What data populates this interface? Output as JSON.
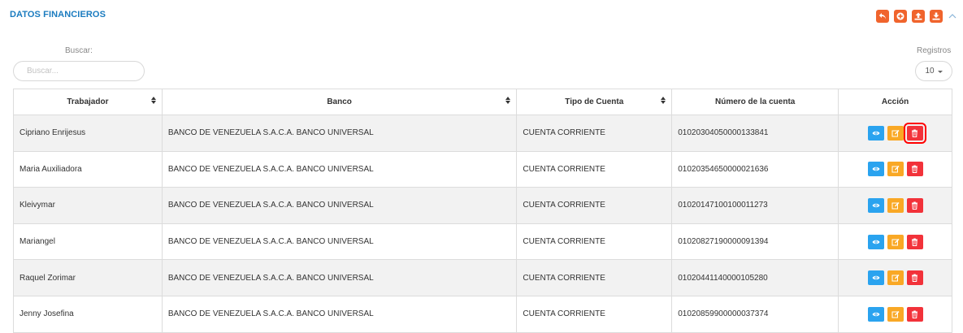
{
  "header": {
    "title": "DATOS FINANCIEROS",
    "toolbar": [
      {
        "name": "back-button",
        "icon": "undo-icon"
      },
      {
        "name": "add-button",
        "icon": "plus-circle-icon"
      },
      {
        "name": "upload-button",
        "icon": "upload-icon"
      },
      {
        "name": "download-button",
        "icon": "download-icon"
      }
    ],
    "collapse_icon": "chevron-up-icon"
  },
  "search": {
    "label": "Buscar:",
    "placeholder": "Buscar..."
  },
  "records": {
    "label": "Registros",
    "value": "10"
  },
  "table": {
    "columns": [
      "Trabajador",
      "Banco",
      "Tipo de Cuenta",
      "Número de la cuenta",
      "Acción"
    ],
    "rows": [
      {
        "trabajador": "Cipriano Enrijesus",
        "banco": "BANCO DE VENEZUELA S.A.C.A. BANCO UNIVERSAL",
        "tipo": "CUENTA CORRIENTE",
        "numero": "01020304050000133841"
      },
      {
        "trabajador": "Maria Auxiliadora",
        "banco": "BANCO DE VENEZUELA S.A.C.A. BANCO UNIVERSAL",
        "tipo": "CUENTA CORRIENTE",
        "numero": "01020354650000021636"
      },
      {
        "trabajador": "Kleivymar",
        "banco": "BANCO DE VENEZUELA S.A.C.A. BANCO UNIVERSAL",
        "tipo": "CUENTA CORRIENTE",
        "numero": "01020147100100011273"
      },
      {
        "trabajador": "Mariangel",
        "banco": "BANCO DE VENEZUELA S.A.C.A. BANCO UNIVERSAL",
        "tipo": "CUENTA CORRIENTE",
        "numero": "01020827190000091394"
      },
      {
        "trabajador": "Raquel Zorimar",
        "banco": "BANCO DE VENEZUELA S.A.C.A. BANCO UNIVERSAL",
        "tipo": "CUENTA CORRIENTE",
        "numero": "01020441140000105280"
      },
      {
        "trabajador": "Jenny Josefina",
        "banco": "BANCO DE VENEZUELA S.A.C.A. BANCO UNIVERSAL",
        "tipo": "CUENTA CORRIENTE",
        "numero": "01020859900000037374"
      }
    ],
    "row_actions": [
      "eye-icon",
      "edit-icon",
      "trash-icon"
    ]
  },
  "colors": {
    "title": "#1a7bbf",
    "toolbar": "#f0642d",
    "view": "#2aa3ef",
    "edit": "#f9a825",
    "delete": "#f2323a"
  }
}
